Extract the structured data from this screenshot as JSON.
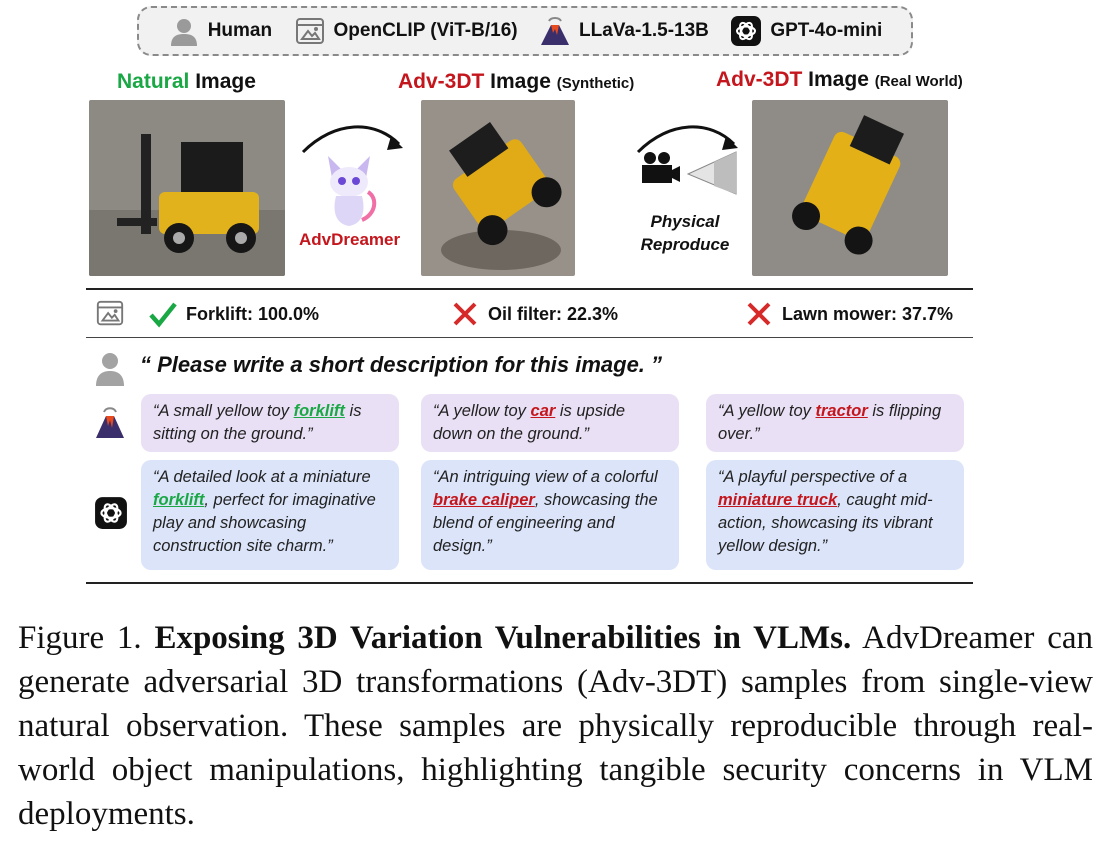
{
  "legend": {
    "human": "Human",
    "openclip": "OpenCLIP (ViT-B/16)",
    "llava": "LLaVa-1.5-13B",
    "gpt": "GPT-4o-mini"
  },
  "columns": {
    "natural": {
      "highlight": "Natural",
      "rest": " Image"
    },
    "synthetic": {
      "highlight": "Adv-3DT",
      "rest": " Image ",
      "sub": "(Synthetic)"
    },
    "real": {
      "highlight": "Adv-3DT",
      "rest": " Image ",
      "sub": "(Real World)"
    }
  },
  "middle": {
    "advdreamer": "AdvDreamer",
    "physical_line1": "Physical",
    "physical_line2": "Reproduce"
  },
  "results": {
    "natural": "Forklift: 100.0%",
    "synthetic": "Oil filter: 22.3%",
    "real": "Lawn mower: 37.7%"
  },
  "prompt": "“ Please write a short description for this image. ”",
  "llava_responses": [
    {
      "pre": "“A small yellow toy ",
      "kw": "forklift",
      "post": " is sitting on the ground.”"
    },
    {
      "pre": "“A yellow toy ",
      "kw": "car",
      "post": " is upside down on the ground.”"
    },
    {
      "pre": "“A yellow toy ",
      "kw": "tractor",
      "post": " is flipping over.”"
    }
  ],
  "gpt_responses": [
    {
      "pre": "“A detailed look at a miniature ",
      "kw": "forklift",
      "post": ", perfect for imaginative play and showcasing construction site charm.”"
    },
    {
      "pre": "“An intriguing view of a colorful ",
      "kw": "brake caliper",
      "post": ", showcasing the blend of engineering and design.”"
    },
    {
      "pre": "“A playful perspective of a ",
      "kw": "miniature truck",
      "post": ", caught mid-action, showcasing its vibrant yellow design.”"
    }
  ],
  "caption": {
    "label": "Figure 1. ",
    "title": "Exposing 3D Variation Vulnerabilities in VLMs.",
    "body": " AdvDreamer can generate adversarial 3D transformations (Adv-3DT) samples from single-view natural observation. These samples are physically reproducible through real-world object manipulations, highlighting tangible security concerns in VLM deployments."
  },
  "colors": {
    "green": "#1aa845",
    "red": "#c4161c",
    "llava_box": "#e9e0f5",
    "gpt_box": "#dbe4f9"
  }
}
